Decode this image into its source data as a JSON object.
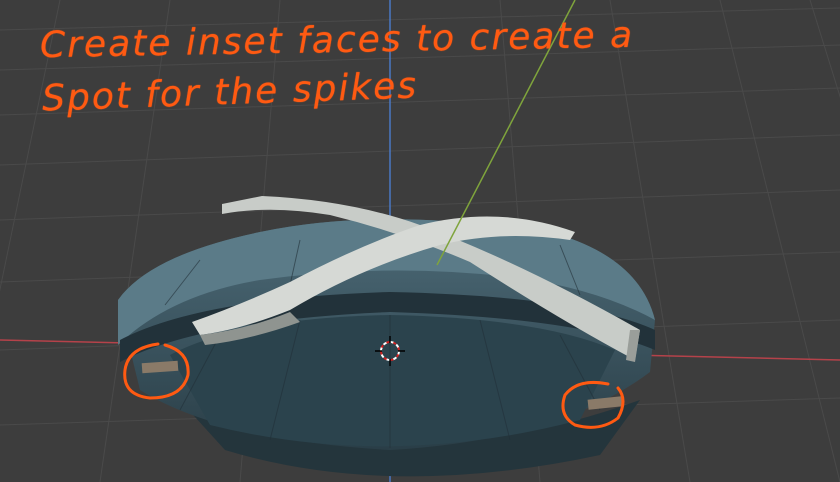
{
  "viewport": {
    "background_color": "#3d3d3d",
    "grid_color": "#4a4a4a",
    "x_axis_color": "#b5424a",
    "y_axis_color": "#7fa43c",
    "z_axis_color": "#4a78c4"
  },
  "annotation": {
    "line1": "Create inset faces to create a",
    "line2": "Spot for the spikes",
    "ink_color": "#ff5a12"
  },
  "model": {
    "body_color": "#3a5560",
    "cross_color": "#c8ccc8"
  },
  "cursor": {
    "icon": "3d-cursor-icon"
  }
}
